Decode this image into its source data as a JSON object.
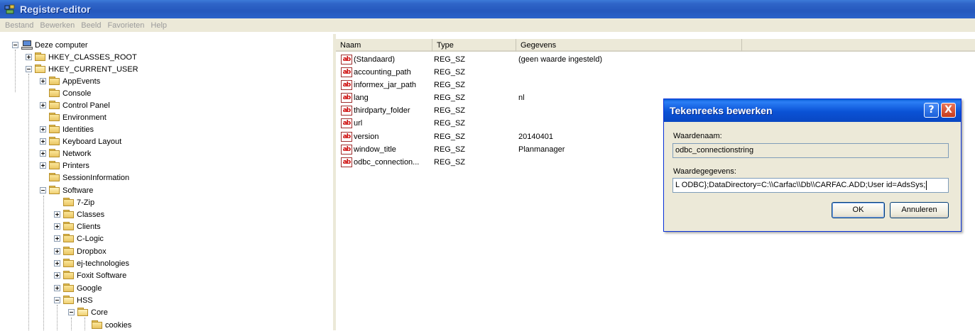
{
  "window": {
    "title": "Register-editor"
  },
  "menu": [
    "Bestand",
    "Bewerken",
    "Beeld",
    "Favorieten",
    "Help"
  ],
  "tree": {
    "root": "Deze computer",
    "nodes": [
      "HKEY_CLASSES_ROOT",
      "HKEY_CURRENT_USER",
      "AppEvents",
      "Console",
      "Control Panel",
      "Environment",
      "Identities",
      "Keyboard Layout",
      "Network",
      "Printers",
      "SessionInformation",
      "Software",
      "7-Zip",
      "Classes",
      "Clients",
      "C-Logic",
      "Dropbox",
      "ej-technologies",
      "Foxit Software",
      "Google",
      "HSS",
      "Core",
      "cookies"
    ]
  },
  "list": {
    "headers": [
      "Naam",
      "Type",
      "Gegevens"
    ],
    "rows": [
      {
        "name": "(Standaard)",
        "type": "REG_SZ",
        "data": "(geen waarde ingesteld)"
      },
      {
        "name": "accounting_path",
        "type": "REG_SZ",
        "data": ""
      },
      {
        "name": "informex_jar_path",
        "type": "REG_SZ",
        "data": ""
      },
      {
        "name": "lang",
        "type": "REG_SZ",
        "data": "nl"
      },
      {
        "name": "thirdparty_folder",
        "type": "REG_SZ",
        "data": ""
      },
      {
        "name": "url",
        "type": "REG_SZ",
        "data": ""
      },
      {
        "name": "version",
        "type": "REG_SZ",
        "data": "20140401"
      },
      {
        "name": "window_title",
        "type": "REG_SZ",
        "data": "Planmanager"
      },
      {
        "name": "odbc_connection...",
        "type": "REG_SZ",
        "data": ""
      }
    ]
  },
  "dialog": {
    "title": "Tekenreeks bewerken",
    "help_glyph": "?",
    "close_glyph": "X",
    "name_label": "Waardenaam:",
    "name_value": "odbc_connectionstring",
    "data_label": "Waardegegevens:",
    "data_value": "L ODBC};DataDirectory=C:\\\\Carfac\\\\Db\\\\CARFAC.ADD;User id=AdsSys;",
    "ok_label": "OK",
    "cancel_label": "Annuleren"
  }
}
